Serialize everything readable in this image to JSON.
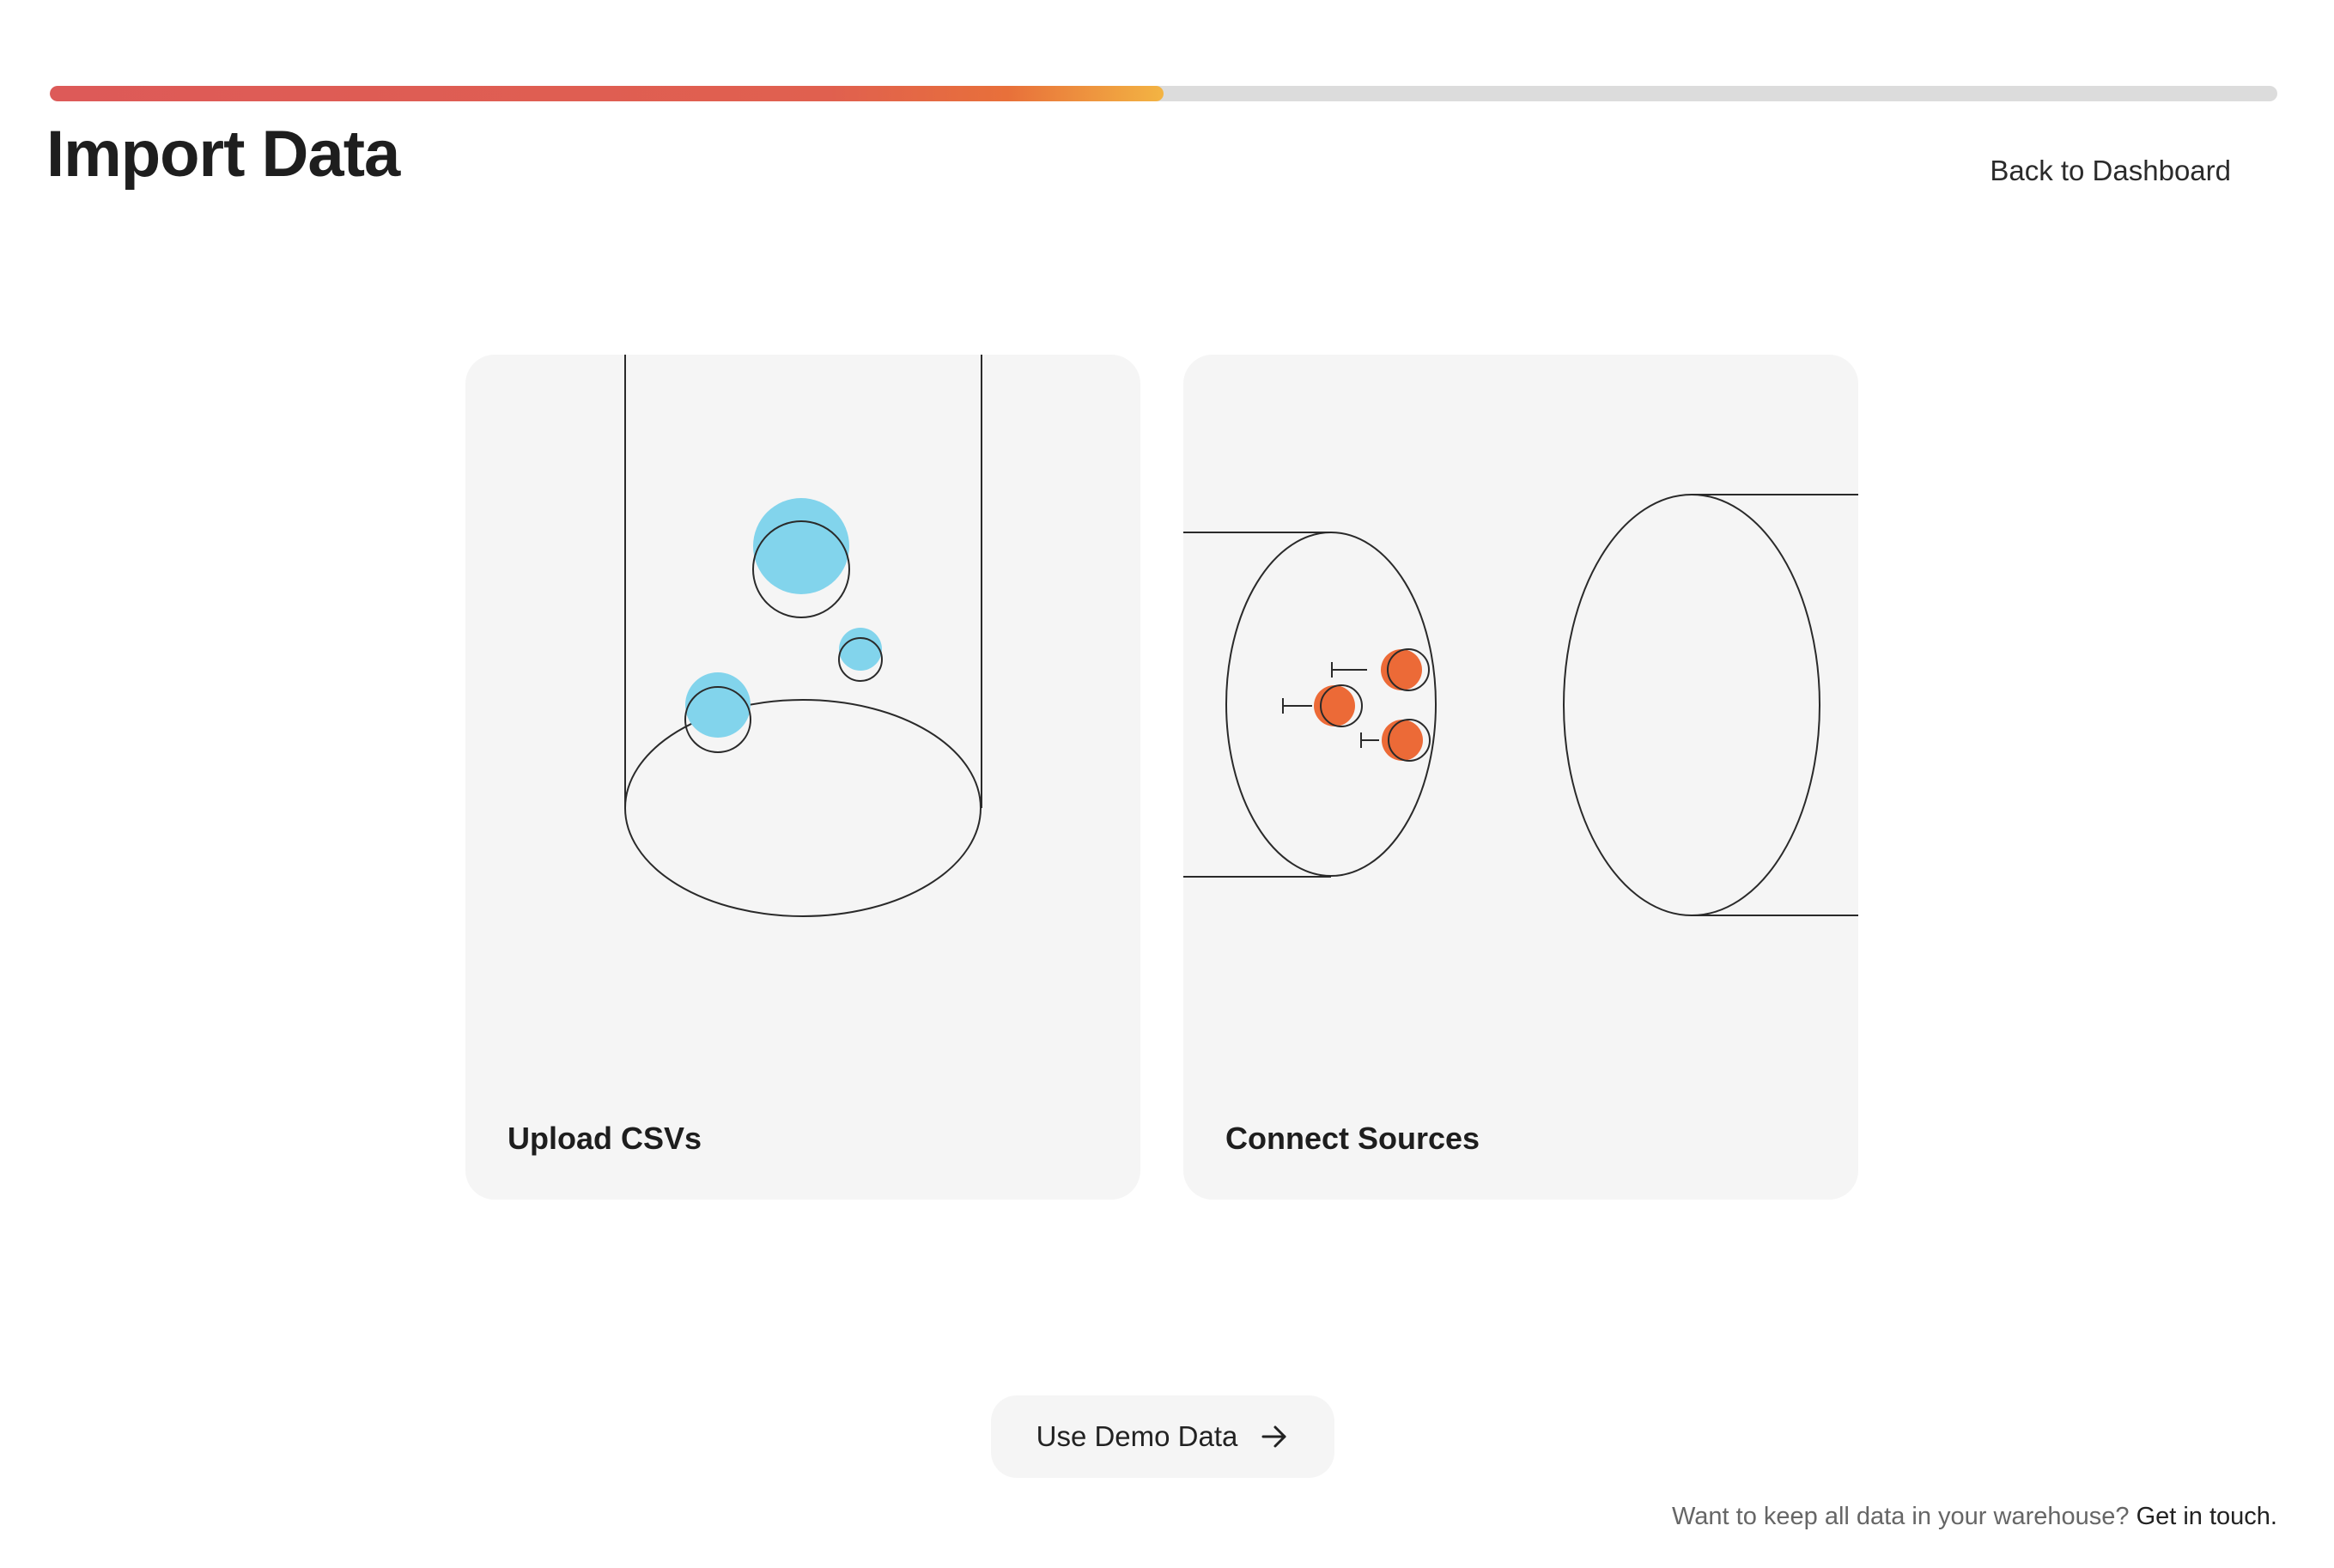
{
  "progress": {
    "value": 0.5
  },
  "header": {
    "title": "Import Data",
    "back_link": "Back to Dashboard"
  },
  "cards": [
    {
      "label": "Upload CSVs",
      "illustration": "csv-funnel-bubbles",
      "accent": "#82d4ec"
    },
    {
      "label": "Connect Sources",
      "illustration": "pipe-connectors",
      "accent": "#ec6a37"
    }
  ],
  "demo_button": {
    "label": "Use Demo Data",
    "icon": "arrow-right-icon"
  },
  "footer": {
    "text": "Want to keep all data in your warehouse?",
    "link": "Get in touch."
  },
  "colors": {
    "progress_start": "#dd5a58",
    "progress_end": "#f3b443",
    "card_bg": "#f5f5f5"
  }
}
